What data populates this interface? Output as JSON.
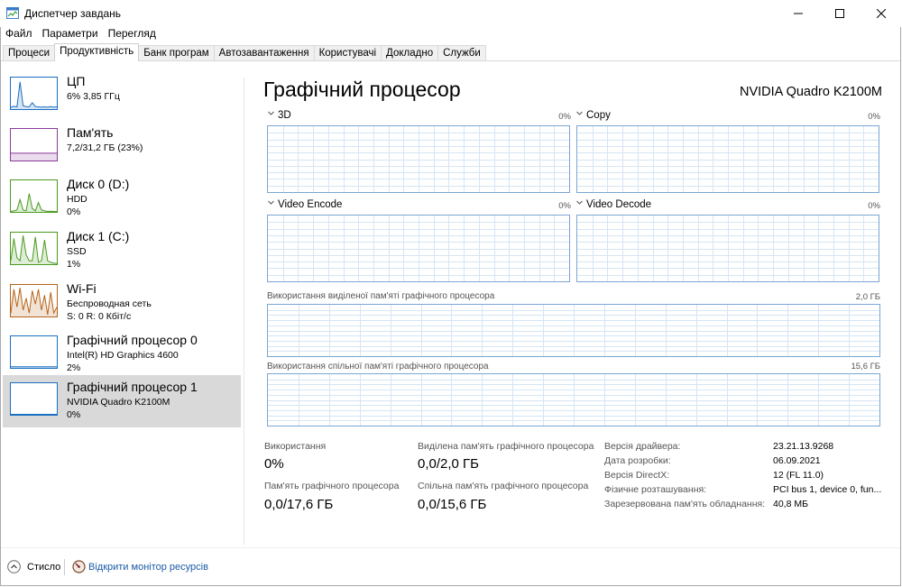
{
  "window": {
    "title": "Диспетчер завдань",
    "controls": {
      "minimize": "minimize-icon",
      "maximize": "maximize-icon",
      "close": "close-icon"
    }
  },
  "menu": [
    "Файл",
    "Параметри",
    "Перегляд"
  ],
  "tabs": [
    "Процеси",
    "Продуктивність",
    "Банк програм",
    "Автозавантаження",
    "Користувачі",
    "Докладно",
    "Служби"
  ],
  "active_tab": "Продуктивність",
  "colors": {
    "cpu": "#1a6fc1",
    "memory": "#8b3a9b",
    "disk": "#4a9a1f",
    "wifi": "#b4641a",
    "gpu": "#1a6fc1",
    "chart_border": "#7aa6d4",
    "grid": "#d6e5f4",
    "selected": "#d9d9d9",
    "link": "#1a5aa6"
  },
  "sidebar": [
    {
      "title": "ЦП",
      "line2": "6% 3,85 ГГц",
      "line3": "",
      "color": "#1a6fc1",
      "trace": [
        0.05,
        0.08,
        0.06,
        0.9,
        0.1,
        0.07,
        0.06,
        0.2,
        0.07,
        0.06,
        0.05,
        0.06,
        0.05,
        0.07,
        0.05,
        0.06
      ]
    },
    {
      "title": "Пам'ять",
      "line2": "7,2/31,2 ГБ (23%)",
      "line3": "",
      "color": "#8b3a9b",
      "trace": [
        0.23,
        0.23,
        0.23,
        0.23,
        0.23,
        0.23,
        0.23,
        0.23,
        0.23,
        0.23,
        0.23,
        0.23,
        0.23,
        0.23,
        0.23,
        0.23
      ]
    },
    {
      "title": "Диск 0 (D:)",
      "line2": "HDD",
      "line3": "0%",
      "color": "#4a9a1f",
      "trace": [
        0,
        0.02,
        0.05,
        0.4,
        0.05,
        0.02,
        0.6,
        0.1,
        0.02,
        0.3,
        0.05,
        0.02,
        0,
        0.01,
        0,
        0
      ]
    },
    {
      "title": "Диск 1 (C:)",
      "line2": "SSD",
      "line3": "1%",
      "color": "#4a9a1f",
      "trace": [
        0.1,
        0.85,
        0.2,
        0.1,
        0.95,
        0.3,
        0.1,
        0.1,
        0.9,
        0.05,
        0.1,
        0.8,
        0.1,
        0.05,
        0.02,
        0.01
      ]
    },
    {
      "title": "Wi-Fi",
      "line2": "Беспроводная сеть",
      "line3": "S: 0 R: 0 Кбіт/с",
      "color": "#b4641a",
      "trace": [
        0.1,
        0.9,
        0.3,
        0.95,
        0.2,
        0.6,
        0.1,
        0.85,
        0.4,
        0.9,
        0.2,
        0.7,
        0.05,
        0.8,
        0.1,
        0.3
      ]
    },
    {
      "title": "Графічний процесор 0",
      "line2": "Intel(R) HD Graphics 4600",
      "line3": "2%",
      "color": "#1a6fc1",
      "trace": [
        0.02,
        0.02,
        0.02,
        0.02,
        0.02,
        0.02,
        0.02,
        0.02,
        0.02,
        0.02,
        0.02,
        0.02,
        0.02,
        0.02,
        0.02,
        0.02
      ]
    },
    {
      "title": "Графічний процесор 1",
      "line2": "NVIDIA Quadro K2100M",
      "line3": "0%",
      "color": "#1a6fc1",
      "trace": [
        0,
        0,
        0,
        0,
        0,
        0,
        0,
        0,
        0,
        0,
        0,
        0,
        0,
        0,
        0,
        0
      ]
    }
  ],
  "selected_index": 6,
  "main": {
    "title": "Графічний процесор",
    "model": "NVIDIA Quadro K2100M",
    "engines": [
      {
        "label": "3D",
        "value": "0%"
      },
      {
        "label": "Copy",
        "value": "0%"
      },
      {
        "label": "Video Encode",
        "value": "0%"
      },
      {
        "label": "Video Decode",
        "value": "0%"
      }
    ],
    "dedicated_memory_chart": {
      "label": "Використання виділеної пам'яті графічного процесора",
      "max": "2,0 ГБ"
    },
    "shared_memory_chart": {
      "label": "Використання спільної пам'яті графічного процесора",
      "max": "15,6 ГБ"
    },
    "stats": {
      "utilization_label": "Використання",
      "utilization_value": "0%",
      "dedicated_label": "Виділена пам'ять графічного процесора",
      "dedicated_value": "0,0/2,0 ГБ",
      "gpu_memory_label": "Пам'ять графічного процесора",
      "gpu_memory_value": "0,0/17,6 ГБ",
      "shared_label": "Спільна пам'ять графічного процесора",
      "shared_value": "0,0/15,6 ГБ"
    },
    "details": [
      {
        "label": "Версія драйвера:",
        "value": "23.21.13.9268"
      },
      {
        "label": "Дата розробки:",
        "value": "06.09.2021"
      },
      {
        "label": "Версія DirectX:",
        "value": "12 (FL 11.0)"
      },
      {
        "label": "Фізичне розташування:",
        "value": "PCI bus 1, device 0, fun..."
      },
      {
        "label": "Зарезервована пам'ять обладнання:",
        "value": "40,8 МБ"
      }
    ]
  },
  "footer": {
    "less_label": "Стисло",
    "resource_monitor_link": "Відкрити монітор ресурсів"
  }
}
